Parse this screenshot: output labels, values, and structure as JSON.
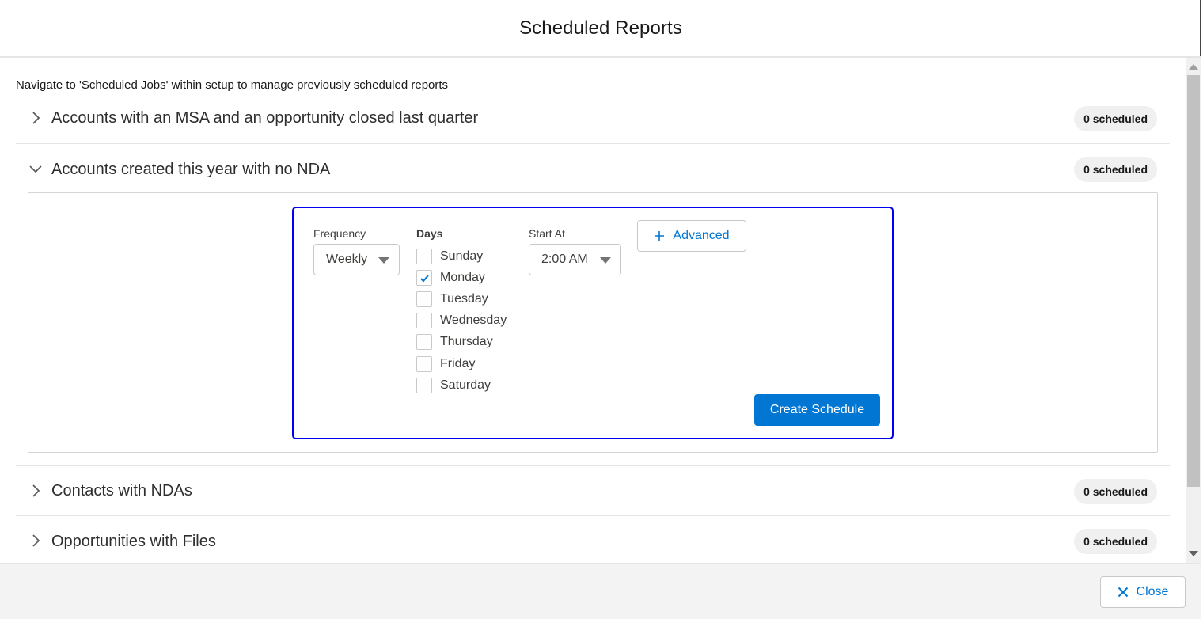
{
  "modal": {
    "title": "Scheduled Reports"
  },
  "notice": "Navigate to 'Scheduled Jobs' within setup to manage previously scheduled reports",
  "reports": [
    {
      "title": "Accounts with an MSA and an opportunity closed last quarter",
      "badge": "0 scheduled",
      "expanded": false,
      "icon": "chevron-right-icon"
    },
    {
      "title": "Accounts created this year with no NDA",
      "badge": "0 scheduled",
      "expanded": true,
      "icon": "chevron-down-icon"
    },
    {
      "title": "Contacts with NDAs",
      "badge": "0 scheduled",
      "expanded": false,
      "icon": "chevron-right-icon"
    },
    {
      "title": "Opportunities with Files",
      "badge": "0 scheduled",
      "expanded": false,
      "icon": "chevron-right-icon"
    }
  ],
  "schedule_form": {
    "frequency_label": "Frequency",
    "frequency_value": "Weekly",
    "days_label": "Days",
    "days": [
      {
        "label": "Sunday",
        "checked": false
      },
      {
        "label": "Monday",
        "checked": true
      },
      {
        "label": "Tuesday",
        "checked": false
      },
      {
        "label": "Wednesday",
        "checked": false
      },
      {
        "label": "Thursday",
        "checked": false
      },
      {
        "label": "Friday",
        "checked": false
      },
      {
        "label": "Saturday",
        "checked": false
      }
    ],
    "start_at_label": "Start At",
    "start_at_value": "2:00 AM",
    "advanced_label": "Advanced",
    "create_label": "Create Schedule"
  },
  "footer": {
    "close_label": "Close"
  },
  "colors": {
    "brand": "#0176d3",
    "focus_outline": "#0000ee",
    "badge_bg": "#f0f0f0"
  }
}
